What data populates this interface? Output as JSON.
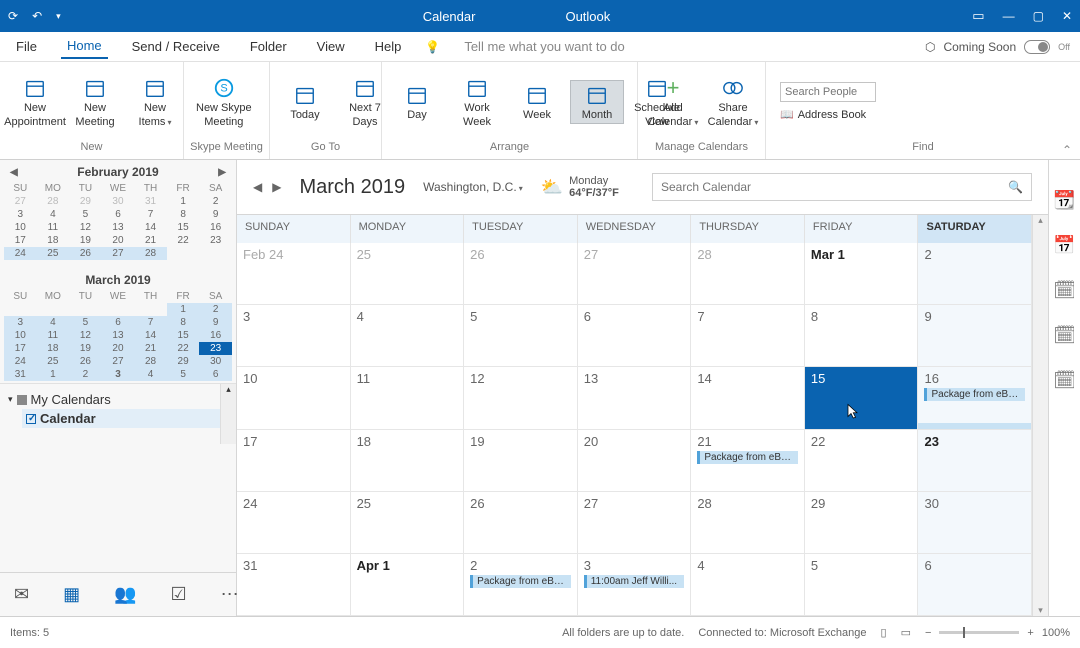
{
  "titlebar": {
    "title1": "Calendar",
    "title2": "Outlook"
  },
  "menubar": {
    "tabs": [
      "File",
      "Home",
      "Send / Receive",
      "Folder",
      "View",
      "Help"
    ],
    "tellme": "Tell me what you want to do",
    "coming": "Coming Soon",
    "toggle": "Off"
  },
  "ribbon": {
    "new": {
      "label": "New",
      "btns": [
        {
          "t1": "New",
          "t2": "Appointment"
        },
        {
          "t1": "New",
          "t2": "Meeting"
        },
        {
          "t1": "New",
          "t2": "Items",
          "caret": true
        }
      ]
    },
    "skype": {
      "label": "Skype Meeting",
      "btn": {
        "t1": "New Skype",
        "t2": "Meeting"
      }
    },
    "goto": {
      "label": "Go To",
      "btns": [
        {
          "t1": "Today"
        },
        {
          "t1": "Next 7",
          "t2": "Days"
        }
      ]
    },
    "arrange": {
      "label": "Arrange",
      "btns": [
        {
          "t1": "Day"
        },
        {
          "t1": "Work",
          "t2": "Week"
        },
        {
          "t1": "Week"
        },
        {
          "t1": "Month",
          "sel": true
        },
        {
          "t1": "Schedule",
          "t2": "View"
        }
      ]
    },
    "manage": {
      "label": "Manage Calendars",
      "btns": [
        {
          "t1": "Add",
          "t2": "Calendar",
          "caret": true
        },
        {
          "t1": "Share",
          "t2": "Calendar",
          "caret": true
        }
      ]
    },
    "find": {
      "label": "Find",
      "placeholder": "Search People",
      "ab": "Address Book"
    }
  },
  "minical1": {
    "title": "February 2019",
    "dow": [
      "SU",
      "MO",
      "TU",
      "WE",
      "TH",
      "FR",
      "SA"
    ],
    "rows": [
      [
        {
          "d": "27",
          "dim": true
        },
        {
          "d": "28",
          "dim": true
        },
        {
          "d": "29",
          "dim": true
        },
        {
          "d": "30",
          "dim": true
        },
        {
          "d": "31",
          "dim": true
        },
        {
          "d": "1"
        },
        {
          "d": "2"
        }
      ],
      [
        {
          "d": "3"
        },
        {
          "d": "4"
        },
        {
          "d": "5"
        },
        {
          "d": "6"
        },
        {
          "d": "7"
        },
        {
          "d": "8"
        },
        {
          "d": "9"
        }
      ],
      [
        {
          "d": "10"
        },
        {
          "d": "11"
        },
        {
          "d": "12"
        },
        {
          "d": "13"
        },
        {
          "d": "14"
        },
        {
          "d": "15"
        },
        {
          "d": "16"
        }
      ],
      [
        {
          "d": "17"
        },
        {
          "d": "18"
        },
        {
          "d": "19"
        },
        {
          "d": "20"
        },
        {
          "d": "21"
        },
        {
          "d": "22"
        },
        {
          "d": "23"
        }
      ],
      [
        {
          "d": "24",
          "hl": true
        },
        {
          "d": "25",
          "hl": true
        },
        {
          "d": "26",
          "hl": true
        },
        {
          "d": "27",
          "hl": true
        },
        {
          "d": "28",
          "hl": true
        },
        {
          "d": ""
        },
        {
          "d": ""
        }
      ]
    ]
  },
  "minical2": {
    "title": "March 2019",
    "dow": [
      "SU",
      "MO",
      "TU",
      "WE",
      "TH",
      "FR",
      "SA"
    ],
    "rows": [
      [
        {
          "d": ""
        },
        {
          "d": ""
        },
        {
          "d": ""
        },
        {
          "d": ""
        },
        {
          "d": ""
        },
        {
          "d": "1",
          "hl": true
        },
        {
          "d": "2",
          "hl": true
        }
      ],
      [
        {
          "d": "3",
          "hl": true
        },
        {
          "d": "4",
          "hl": true
        },
        {
          "d": "5",
          "hl": true
        },
        {
          "d": "6",
          "hl": true
        },
        {
          "d": "7",
          "hl": true
        },
        {
          "d": "8",
          "hl": true
        },
        {
          "d": "9",
          "hl": true
        }
      ],
      [
        {
          "d": "10",
          "hl": true
        },
        {
          "d": "11",
          "hl": true
        },
        {
          "d": "12",
          "hl": true
        },
        {
          "d": "13",
          "hl": true
        },
        {
          "d": "14",
          "hl": true
        },
        {
          "d": "15",
          "hl": true
        },
        {
          "d": "16",
          "hl": true
        }
      ],
      [
        {
          "d": "17",
          "hl": true
        },
        {
          "d": "18",
          "hl": true
        },
        {
          "d": "19",
          "hl": true
        },
        {
          "d": "20",
          "hl": true
        },
        {
          "d": "21",
          "hl": true
        },
        {
          "d": "22",
          "hl": true
        },
        {
          "d": "23",
          "today": true
        }
      ],
      [
        {
          "d": "24",
          "hl": true
        },
        {
          "d": "25",
          "hl": true
        },
        {
          "d": "26",
          "hl": true
        },
        {
          "d": "27",
          "hl": true
        },
        {
          "d": "28",
          "hl": true
        },
        {
          "d": "29",
          "hl": true
        },
        {
          "d": "30",
          "hl": true
        }
      ],
      [
        {
          "d": "31",
          "hl": true
        },
        {
          "d": "1",
          "hl": true
        },
        {
          "d": "2",
          "hl": true
        },
        {
          "d": "3",
          "hl": true,
          "b": true
        },
        {
          "d": "4",
          "hl": true
        },
        {
          "d": "5",
          "hl": true
        },
        {
          "d": "6",
          "hl": true
        }
      ]
    ]
  },
  "mycal": {
    "header": "My Calendars",
    "item": "Calendar"
  },
  "calhdr": {
    "month": "March 2019",
    "loc": "Washington,  D.C.",
    "wday": "Monday",
    "wtemp": "64°F/37°F",
    "search": "Search Calendar"
  },
  "dayheaders": [
    "SUNDAY",
    "MONDAY",
    "TUESDAY",
    "WEDNESDAY",
    "THURSDAY",
    "FRIDAY",
    "SATURDAY"
  ],
  "weeks": [
    [
      {
        "n": "Feb 24",
        "dim": true
      },
      {
        "n": "25",
        "dim": true
      },
      {
        "n": "26",
        "dim": true
      },
      {
        "n": "27",
        "dim": true
      },
      {
        "n": "28",
        "dim": true
      },
      {
        "n": "Mar 1",
        "bold": true
      },
      {
        "n": "2"
      }
    ],
    [
      {
        "n": "3"
      },
      {
        "n": "4"
      },
      {
        "n": "5"
      },
      {
        "n": "6"
      },
      {
        "n": "7"
      },
      {
        "n": "8"
      },
      {
        "n": "9"
      }
    ],
    [
      {
        "n": "10"
      },
      {
        "n": "11"
      },
      {
        "n": "12"
      },
      {
        "n": "13"
      },
      {
        "n": "14"
      },
      {
        "n": "15",
        "sel": true,
        "cursor": true
      },
      {
        "n": "16",
        "evt": "Package from eBa...",
        "span": true
      }
    ],
    [
      {
        "n": "17"
      },
      {
        "n": "18"
      },
      {
        "n": "19"
      },
      {
        "n": "20"
      },
      {
        "n": "21",
        "evt": "Package from eBa..."
      },
      {
        "n": "22"
      },
      {
        "n": "23",
        "bold": true
      }
    ],
    [
      {
        "n": "24"
      },
      {
        "n": "25"
      },
      {
        "n": "26"
      },
      {
        "n": "27"
      },
      {
        "n": "28"
      },
      {
        "n": "29"
      },
      {
        "n": "30"
      }
    ],
    [
      {
        "n": "31"
      },
      {
        "n": "Apr 1",
        "bold": true
      },
      {
        "n": "2",
        "evt": "Package from eBa..."
      },
      {
        "n": "3",
        "evt": "11:00am Jeff Willi..."
      },
      {
        "n": "4"
      },
      {
        "n": "5"
      },
      {
        "n": "6"
      }
    ]
  ],
  "status": {
    "items": "Items: 5",
    "sync": "All folders are up to date.",
    "conn": "Connected to: Microsoft Exchange",
    "zoom": "100%"
  }
}
